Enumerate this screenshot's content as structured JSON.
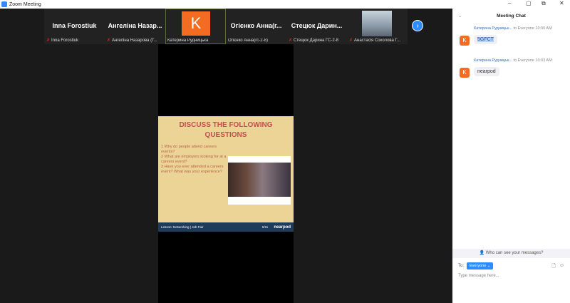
{
  "window": {
    "title": "Zoom Meeting",
    "controls": [
      "–",
      "▢",
      "⧉",
      "✕"
    ]
  },
  "participants": [
    {
      "big": "Inna Forostiuk",
      "name": "Inna Forostiuk",
      "muted": true,
      "type": "name"
    },
    {
      "big": "Ангеліна Назар...",
      "name": "Ангеліна Назарова (Г...",
      "muted": true,
      "type": "name"
    },
    {
      "big": "K",
      "name": "Катерина Рудницька",
      "muted": false,
      "type": "avatar"
    },
    {
      "big": "Огієнко Анна(г...",
      "name": "Огієнко Анна(гс-2-8)",
      "muted": false,
      "type": "name"
    },
    {
      "big": "Стецюк Дарин...",
      "name": "Стецюк Дарина ГС-2-8",
      "muted": true,
      "type": "name"
    },
    {
      "big": "",
      "name": "Анастасія Соколова Г...",
      "muted": true,
      "type": "photo"
    }
  ],
  "next_icon": "›",
  "slide": {
    "title": "DISCUSS THE FOLLOWING QUESTIONS",
    "questions": [
      "1 Why do people attend careers events?",
      "2 What are employers looking for at a careers event?",
      "3 Have you ever attended a careers event? What was your experience?"
    ],
    "footer_left": "Lesson: Networking | Job Fair",
    "footer_page": "5/11",
    "footer_brand": "nearpod"
  },
  "chat": {
    "title": "Meeting Chat",
    "messages": [
      {
        "sender": "Катерина Рудницьк...",
        "to": "to Everyone",
        "time": "10:00 AM",
        "avatar": "K",
        "text": "5GFCT"
      },
      {
        "sender": "Катерина Рудницьк...",
        "to": "to Everyone",
        "time": "10:03 AM",
        "avatar": "K",
        "text": "nearpod"
      }
    ],
    "who_can_see": "Who can see your messages?",
    "to_label": "To:",
    "to_value": "Everyone ⌄",
    "placeholder": "Type message here..."
  },
  "colors": {
    "accent": "#2d8cff",
    "avatar": "#f26d21"
  }
}
